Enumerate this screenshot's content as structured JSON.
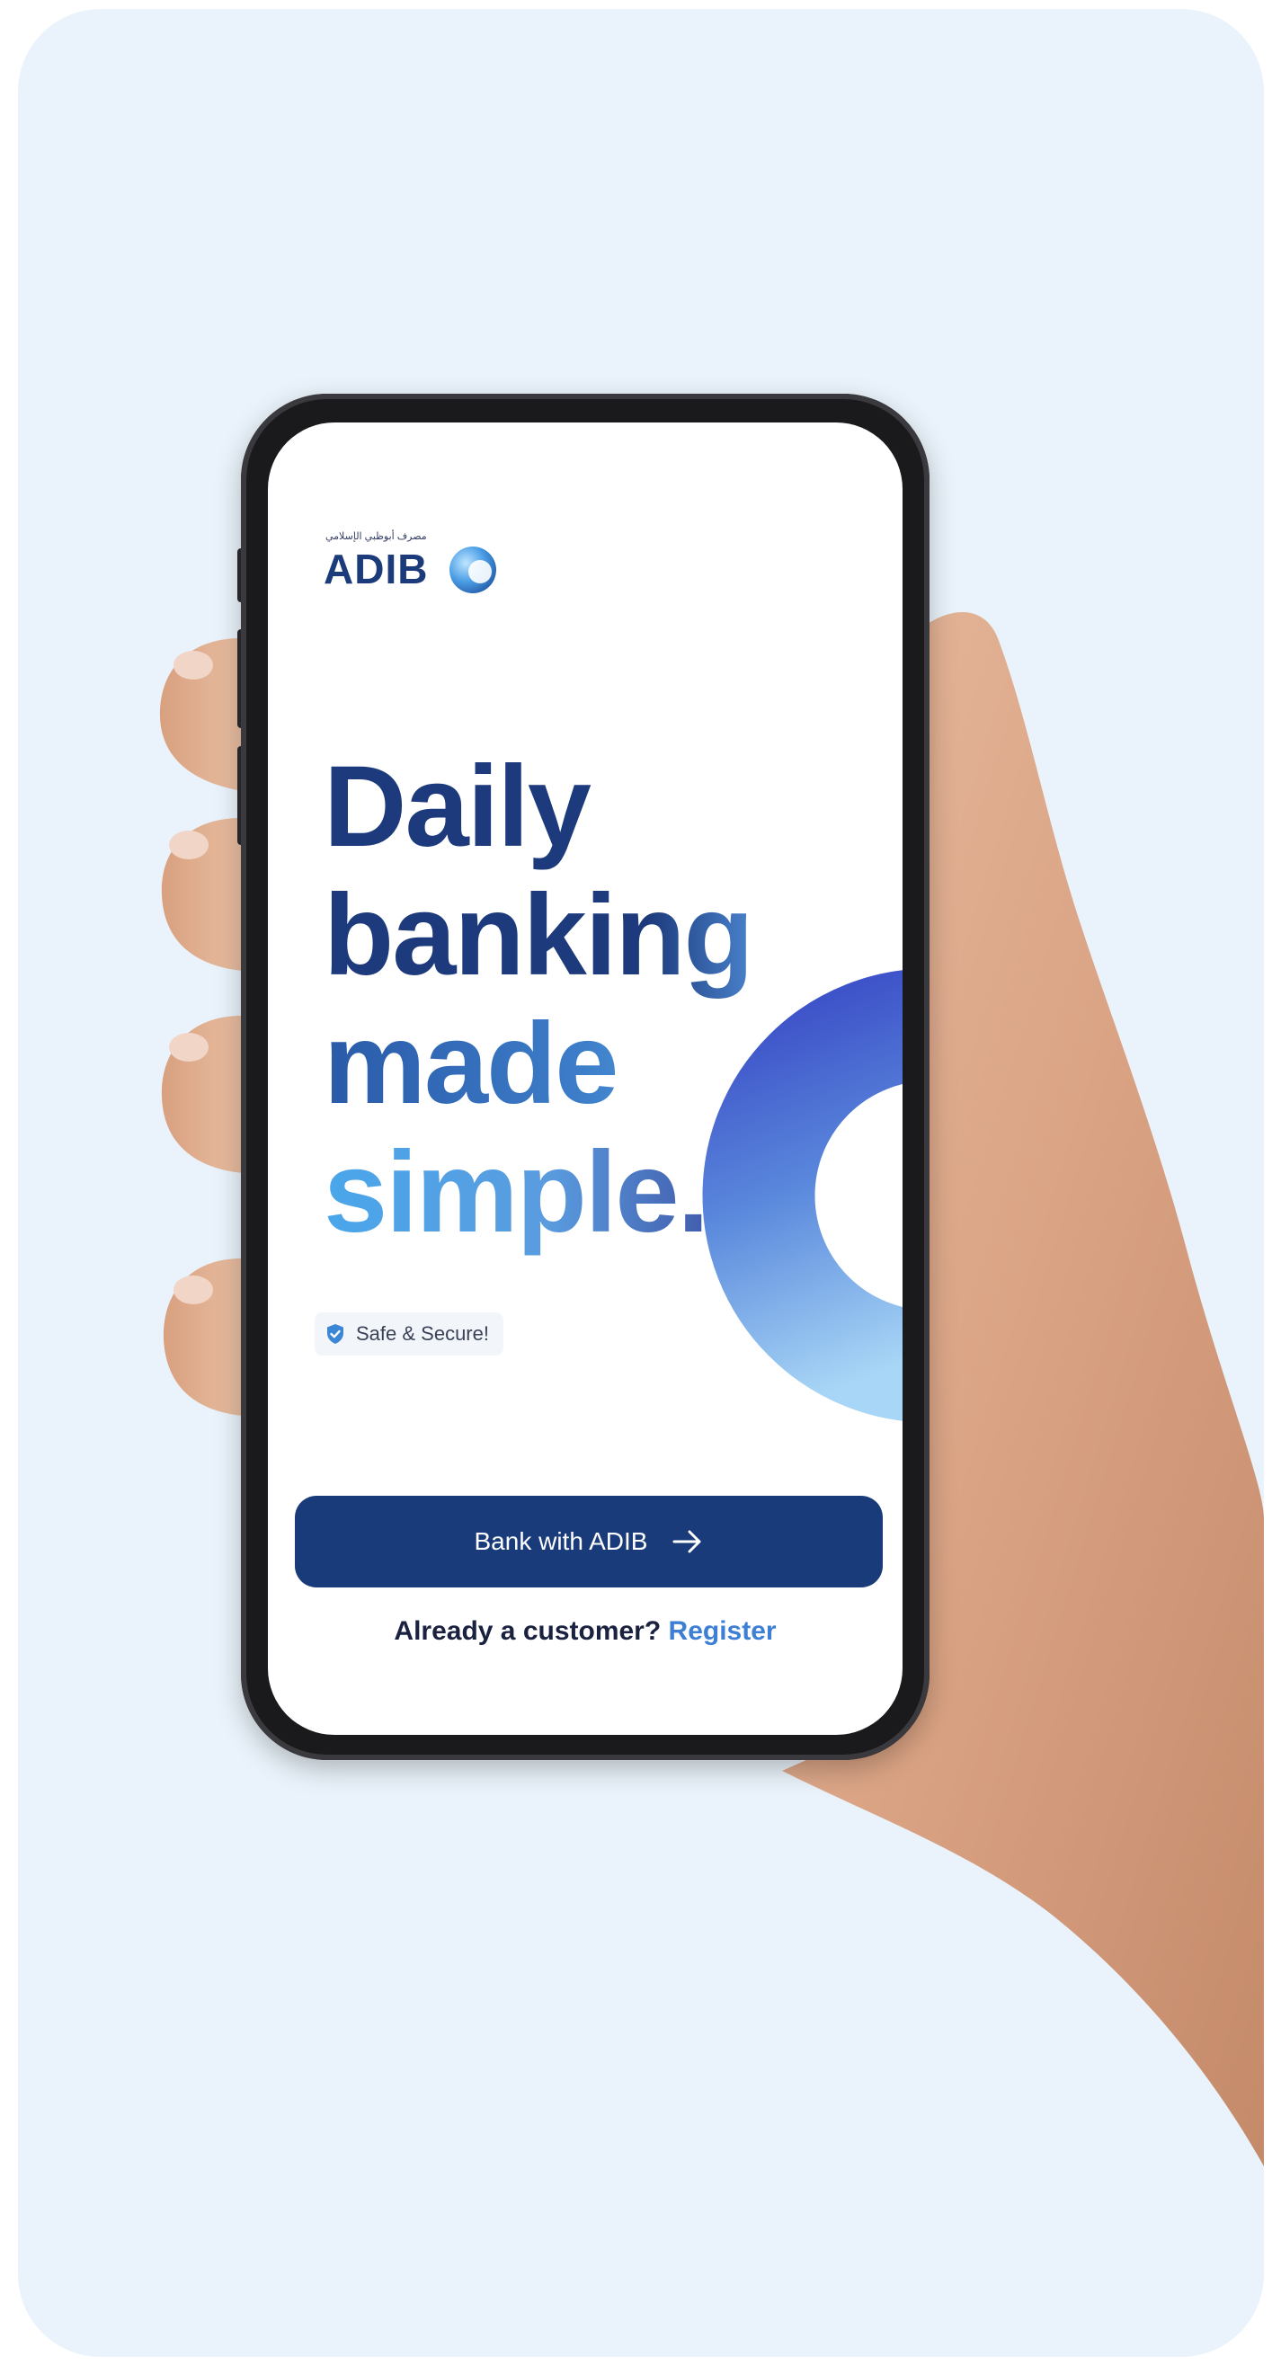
{
  "logo": {
    "arabic_text": "مصرف أبوظبي الإسلامي",
    "brand": "ADIB"
  },
  "headline": {
    "line1": "Daily",
    "line2": "banking",
    "line3": "made",
    "line4": "simple."
  },
  "badge": {
    "label": "Safe & Secure!",
    "icon": "shield-check-icon"
  },
  "cta": {
    "label": "Bank with ADIB",
    "icon": "arrow-right-icon"
  },
  "footer": {
    "prompt": "Already a customer?",
    "link": "Register"
  },
  "colors": {
    "background": "#eaf3fb",
    "navy": "#1a3b79",
    "link": "#3c7fd4",
    "accent_light": "#86c2ee",
    "accent_purple": "#3a2f86"
  }
}
